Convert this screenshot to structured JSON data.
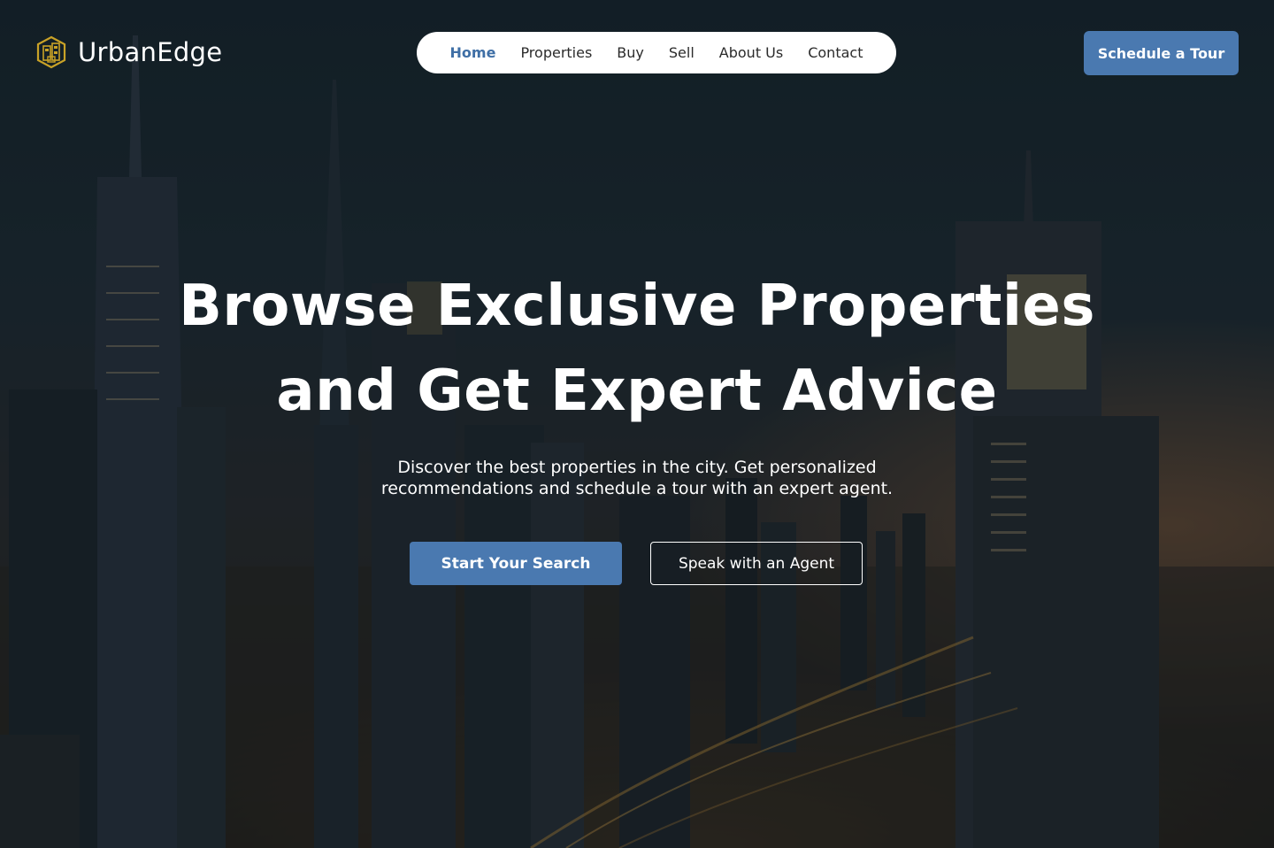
{
  "brand": {
    "name": "UrbanEdge",
    "icon": "building-hexagon-icon",
    "icon_color": "#c9a227"
  },
  "nav": {
    "items": [
      {
        "label": "Home",
        "active": true
      },
      {
        "label": "Properties",
        "active": false
      },
      {
        "label": "Buy",
        "active": false
      },
      {
        "label": "Sell",
        "active": false
      },
      {
        "label": "About Us",
        "active": false
      },
      {
        "label": "Contact",
        "active": false
      }
    ]
  },
  "header": {
    "cta_label": "Schedule a Tour"
  },
  "hero": {
    "title_line1": "Browse Exclusive Properties",
    "title_line2": "and Get Expert Advice",
    "subtitle_line1": "Discover the best properties in the city. Get personalized",
    "subtitle_line2": "recommendations and schedule a tour with an expert agent.",
    "primary_cta": "Start Your Search",
    "secondary_cta": "Speak with an Agent"
  },
  "colors": {
    "accent": "#4a79b0",
    "nav_active": "#3f6fa6",
    "nav_bg": "#ffffff"
  }
}
